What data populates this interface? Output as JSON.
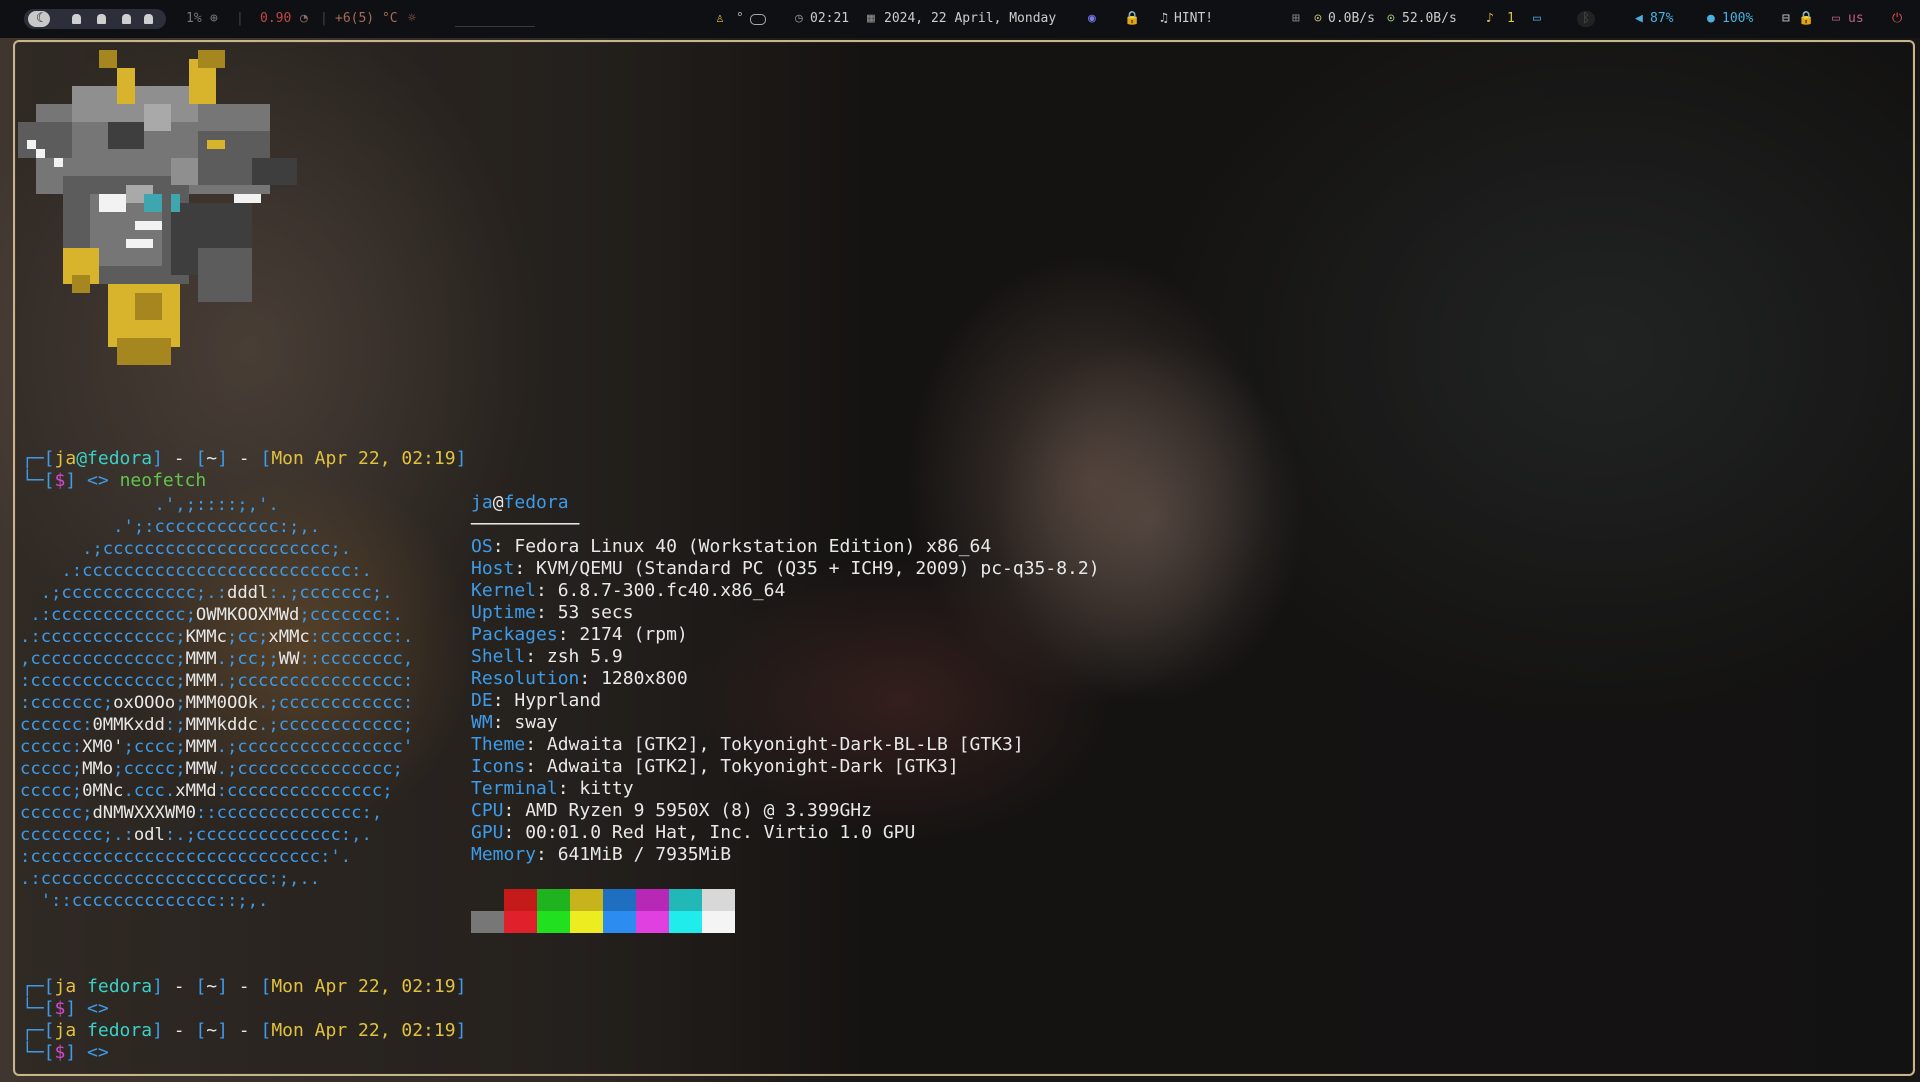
{
  "topbar": {
    "cpu": "1%",
    "load": "0.90",
    "temp": "+6(5) °C",
    "time": "02:21",
    "date": "2024, 22 April, Monday",
    "hint": "HINT!",
    "net_up": "0.0B/s",
    "net_down": "52.0B/s",
    "notif_count": "1",
    "volume": "87%",
    "mic": "100%",
    "layout": "us"
  },
  "prompts": [
    {
      "user": "ja",
      "host": "fedora",
      "dir": "~",
      "date": "Mon Apr 22, 02:19",
      "cmd": "neofetch"
    },
    {
      "user": "ja",
      "host": "fedora",
      "dir": "~",
      "date": "Mon Apr 22, 02:19",
      "cmd": ""
    },
    {
      "user": "ja",
      "host": "fedora",
      "dir": "~",
      "date": "Mon Apr 22, 02:19",
      "cmd": ""
    }
  ],
  "prompt_parts": {
    "sym": "$",
    "arrow": "<>",
    "at": "@"
  },
  "neofetch": {
    "title_user": "ja",
    "title_host": "fedora",
    "underline": "──────────",
    "fields": [
      {
        "key": "OS",
        "value": "Fedora Linux 40 (Workstation Edition) x86_64"
      },
      {
        "key": "Host",
        "value": "KVM/QEMU (Standard PC (Q35 + ICH9, 2009) pc-q35-8.2)"
      },
      {
        "key": "Kernel",
        "value": "6.8.7-300.fc40.x86_64"
      },
      {
        "key": "Uptime",
        "value": "53 secs"
      },
      {
        "key": "Packages",
        "value": "2174 (rpm)"
      },
      {
        "key": "Shell",
        "value": "zsh 5.9"
      },
      {
        "key": "Resolution",
        "value": "1280x800"
      },
      {
        "key": "DE",
        "value": "Hyprland"
      },
      {
        "key": "WM",
        "value": "sway"
      },
      {
        "key": "Theme",
        "value": "Adwaita [GTK2], Tokyonight-Dark-BL-LB [GTK3]"
      },
      {
        "key": "Icons",
        "value": "Adwaita [GTK2], Tokyonight-Dark [GTK3]"
      },
      {
        "key": "Terminal",
        "value": "kitty"
      },
      {
        "key": "CPU",
        "value": "AMD Ryzen 9 5950X (8) @ 3.399GHz"
      },
      {
        "key": "GPU",
        "value": "00:01.0 Red Hat, Inc. Virtio 1.0 GPU"
      },
      {
        "key": "Memory",
        "value": "641MiB / 7935MiB"
      }
    ],
    "ascii": [
      "             .',;::::;,'.",
      "         .';:cccccccccccc:;,.",
      "      .;cccccccccccccccccccccc;.",
      "    .:cccccccccccccccccccccccccc:.",
      "  .;ccccccccccccc;.:dddl:.;ccccccc;.",
      " .:ccccccccccccc;OWMKOOXMWd;ccccccc:.",
      ".:ccccccccccccc;KMMc;cc;xMMc:ccccccc:.",
      ",cccccccccccccc;MMM.;cc;;WW::cccccccc,",
      ":cccccccccccccc;MMM.;cccccccccccccccc:",
      ":ccccccc;oxOOOo;MMM0OOk.;cccccccccccc:",
      "cccccc:0MMKxdd:;MMMkddc.;cccccccccccc;",
      "ccccc:XM0';cccc;MMM.;cccccccccccccccc'",
      "ccccc;MMo;ccccc;MMW.;ccccccccccccccc;",
      "ccccc;0MNc.ccc.xMMd:ccccccccccccccc;",
      "cccccc;dNMWXXXWM0::cccccccccccccc:,",
      "cccccccc;.:odl:.;cccccccccccccc:,.",
      ":cccccccccccccccccccccccccccc:'.",
      ".:cccccccccccccccccccccc:;,..",
      "  '::cccccccccccccc::;,."
    ]
  },
  "palette": {
    "normal": [
      "#1a1a1a",
      "#c41a1a",
      "#1fb31f",
      "#c7b41c",
      "#1f6fc0",
      "#b728b7",
      "#22b8b8",
      "#d8d8d8"
    ],
    "bright": [
      "#777777",
      "#e0202a",
      "#20e020",
      "#ecec20",
      "#2c8cf0",
      "#e040e0",
      "#20ecec",
      "#f4f4f4"
    ]
  }
}
